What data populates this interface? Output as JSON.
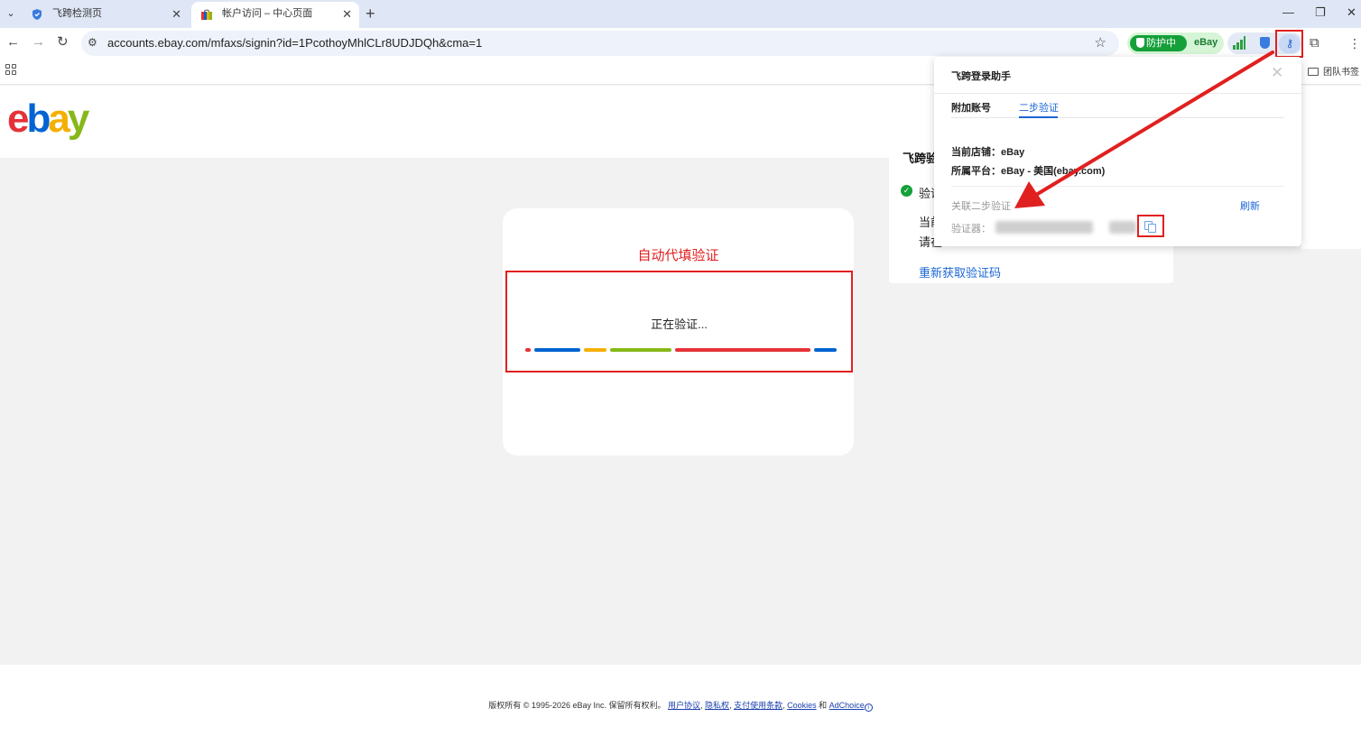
{
  "browser": {
    "tabs": [
      {
        "title": "飞跨检测页",
        "close": "✕"
      },
      {
        "title": "帐户访问 – 中心页面",
        "close": "✕"
      }
    ],
    "new_tab": "+",
    "url": "accounts.ebay.com/mfaxs/signin?id=1PcothoyMhlCLr8UDJDQh&cma=1",
    "window_controls": [
      "—",
      "❐",
      "✕"
    ],
    "extensions": {
      "guard_label": "防护中",
      "guard_site": "eBay",
      "key_icon": "key-icon"
    },
    "bookmarks": {
      "team": "团队书签"
    }
  },
  "logo": {
    "e": "e",
    "b": "b",
    "a": "a",
    "y": "y"
  },
  "verify": {
    "auto_label": "自动代填验证",
    "status": "正在验证...",
    "progress_colors": [
      "#e53238",
      "#0064d2",
      "#f5af02",
      "#86b817",
      "#e53238",
      "#0064d2"
    ]
  },
  "feikua_panel": {
    "title": "飞跨验",
    "step": "验证",
    "line1": "当前",
    "line2": "请在",
    "resend": "重新获取验证码"
  },
  "popup": {
    "title": "飞跨登录助手",
    "close": "✕",
    "tabs": [
      "附加账号",
      "二步验证"
    ],
    "active_tab": "二步验证",
    "store_label": "当前店铺：eBay",
    "platform_label": "所属平台：eBay - 美国(ebay.com)",
    "assoc_label": "关联二步验证",
    "refresh": "刷新",
    "auth_label": "验证器："
  },
  "footer": {
    "prefix": "版权所有 © 1995-2026 eBay Inc. 保留所有权利。",
    "links": [
      "用户协议",
      "隐私权",
      "支付使用条款",
      "Cookies"
    ],
    "and": "和",
    "adchoice": "AdChoice"
  }
}
